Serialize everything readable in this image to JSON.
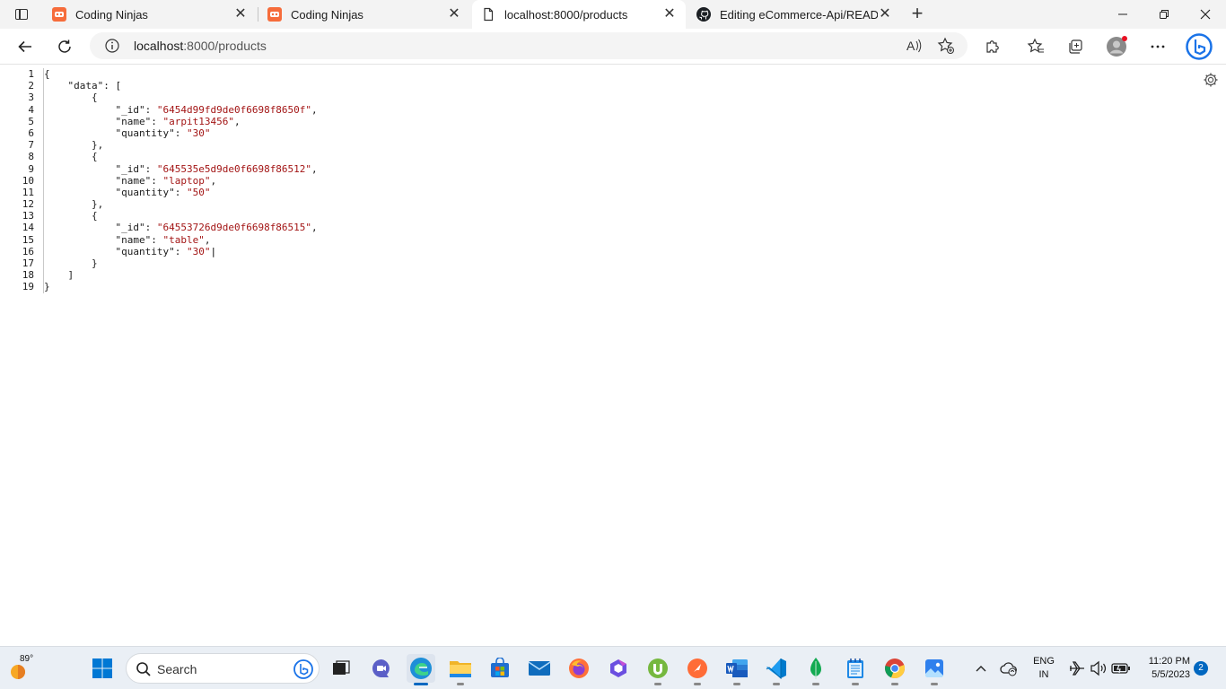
{
  "browser": {
    "tabs": [
      {
        "title": "Coding Ninjas",
        "favicon": "coding-ninjas-icon",
        "active": false
      },
      {
        "title": "Coding Ninjas",
        "favicon": "coding-ninjas-icon",
        "active": false
      },
      {
        "title": "localhost:8000/products",
        "favicon": "page-icon",
        "active": true
      },
      {
        "title": "Editing eCommerce-Api/READM",
        "favicon": "github-icon",
        "active": false
      }
    ],
    "new_tab_label": "+",
    "address": {
      "host": "localhost",
      "path": ":8000/products"
    }
  },
  "json_viewer": {
    "line_numbers": [
      "1",
      "2",
      "3",
      "4",
      "5",
      "6",
      "7",
      "8",
      "9",
      "10",
      "11",
      "12",
      "13",
      "14",
      "15",
      "16",
      "17",
      "18",
      "19"
    ],
    "lines": [
      {
        "indent": "",
        "parts": [
          [
            "p",
            "{"
          ]
        ]
      },
      {
        "indent": "    ",
        "parts": [
          [
            "k",
            "\"data\""
          ],
          [
            "p",
            ": ["
          ]
        ]
      },
      {
        "indent": "        ",
        "parts": [
          [
            "p",
            "{"
          ]
        ]
      },
      {
        "indent": "            ",
        "parts": [
          [
            "k",
            "\"_id\""
          ],
          [
            "p",
            ": "
          ],
          [
            "s",
            "\"6454d99fd9de0f6698f8650f\""
          ],
          [
            "p",
            ","
          ]
        ]
      },
      {
        "indent": "            ",
        "parts": [
          [
            "k",
            "\"name\""
          ],
          [
            "p",
            ": "
          ],
          [
            "s",
            "\"arpit13456\""
          ],
          [
            "p",
            ","
          ]
        ]
      },
      {
        "indent": "            ",
        "parts": [
          [
            "k",
            "\"quantity\""
          ],
          [
            "p",
            ": "
          ],
          [
            "s",
            "\"30\""
          ]
        ]
      },
      {
        "indent": "        ",
        "parts": [
          [
            "p",
            "},"
          ]
        ]
      },
      {
        "indent": "        ",
        "parts": [
          [
            "p",
            "{"
          ]
        ]
      },
      {
        "indent": "            ",
        "parts": [
          [
            "k",
            "\"_id\""
          ],
          [
            "p",
            ": "
          ],
          [
            "s",
            "\"645535e5d9de0f6698f86512\""
          ],
          [
            "p",
            ","
          ]
        ]
      },
      {
        "indent": "            ",
        "parts": [
          [
            "k",
            "\"name\""
          ],
          [
            "p",
            ": "
          ],
          [
            "s",
            "\"laptop\""
          ],
          [
            "p",
            ","
          ]
        ]
      },
      {
        "indent": "            ",
        "parts": [
          [
            "k",
            "\"quantity\""
          ],
          [
            "p",
            ": "
          ],
          [
            "s",
            "\"50\""
          ]
        ]
      },
      {
        "indent": "        ",
        "parts": [
          [
            "p",
            "},"
          ]
        ]
      },
      {
        "indent": "        ",
        "parts": [
          [
            "p",
            "{"
          ]
        ]
      },
      {
        "indent": "            ",
        "parts": [
          [
            "k",
            "\"_id\""
          ],
          [
            "p",
            ": "
          ],
          [
            "s",
            "\"64553726d9de0f6698f86515\""
          ],
          [
            "p",
            ","
          ]
        ]
      },
      {
        "indent": "            ",
        "parts": [
          [
            "k",
            "\"name\""
          ],
          [
            "p",
            ": "
          ],
          [
            "s",
            "\"table\""
          ],
          [
            "p",
            ","
          ]
        ]
      },
      {
        "indent": "            ",
        "parts": [
          [
            "k",
            "\"quantity\""
          ],
          [
            "p",
            ": "
          ],
          [
            "s",
            "\"30\""
          ],
          [
            "c",
            "|"
          ]
        ]
      },
      {
        "indent": "        ",
        "parts": [
          [
            "p",
            "}"
          ]
        ]
      },
      {
        "indent": "    ",
        "parts": [
          [
            "p",
            "]"
          ]
        ]
      },
      {
        "indent": "",
        "parts": [
          [
            "p",
            "}"
          ]
        ]
      }
    ]
  },
  "taskbar": {
    "weather_temp": "89°",
    "search_label": "Search",
    "pinned": [
      "windows-start-icon",
      "search",
      "task-view-icon",
      "chat-icon",
      "edge-icon",
      "file-explorer-icon",
      "microsoft-store-icon",
      "mail-icon",
      "firefox-icon",
      "copilot-icon",
      "utorrent-icon",
      "postman-icon",
      "word-icon",
      "vscode-icon",
      "mongodb-compass-icon",
      "notepad-icon",
      "chrome-icon",
      "photos-icon"
    ],
    "language": {
      "top": "ENG",
      "bottom": "IN"
    },
    "clock": {
      "time": "11:20 PM",
      "date": "5/5/2023"
    },
    "notification_count": "2"
  },
  "colors": {
    "string": "#a31515",
    "accent": "#0067c0",
    "tabbar": "#f3f3f3"
  }
}
